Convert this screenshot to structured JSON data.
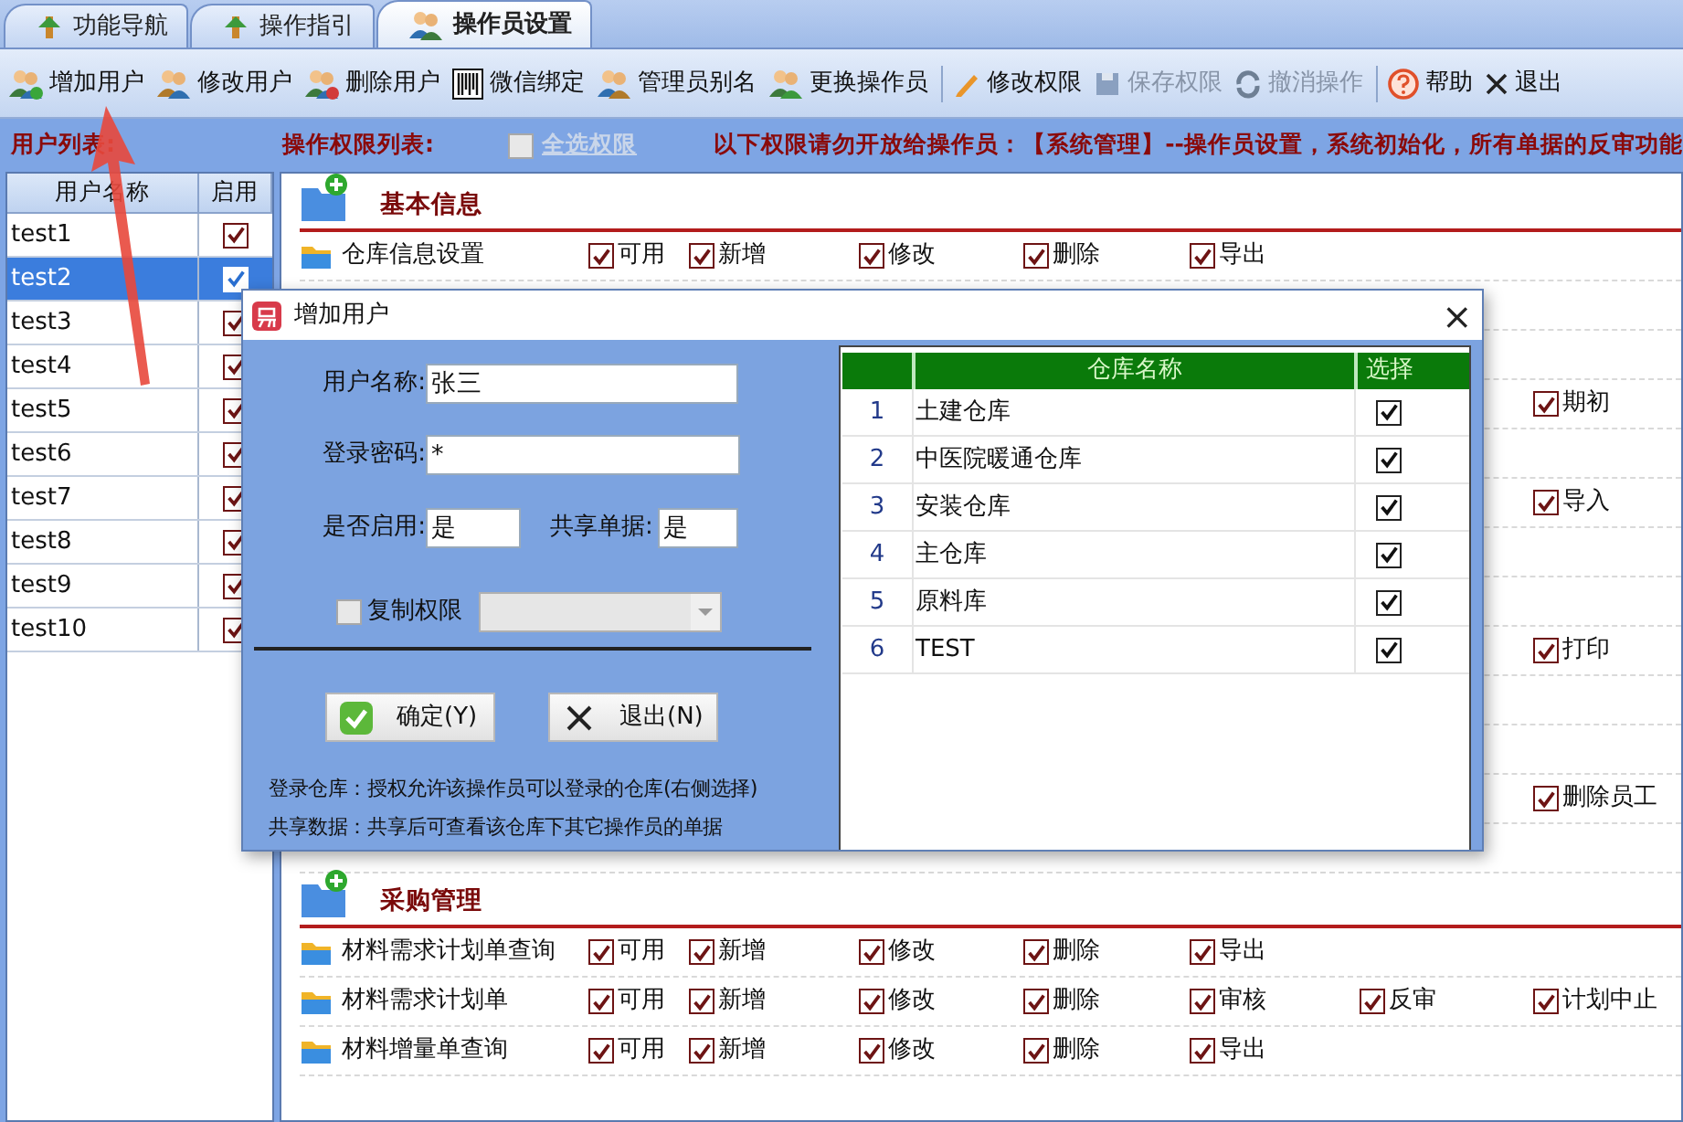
{
  "tabs": [
    {
      "label": "功能导航",
      "selected": false
    },
    {
      "label": "操作指引",
      "selected": false
    },
    {
      "label": "操作员设置",
      "selected": true
    }
  ],
  "toolbar": [
    {
      "kind": "button",
      "label": "增加用户",
      "disabled": false
    },
    {
      "kind": "button",
      "label": "修改用户",
      "disabled": false
    },
    {
      "kind": "button",
      "label": "删除用户",
      "disabled": false
    },
    {
      "kind": "button",
      "label": "微信绑定",
      "disabled": false
    },
    {
      "kind": "button",
      "label": "管理员别名",
      "disabled": false
    },
    {
      "kind": "button",
      "label": "更换操作员",
      "disabled": false
    },
    {
      "kind": "separator"
    },
    {
      "kind": "button",
      "label": "修改权限",
      "disabled": false
    },
    {
      "kind": "button",
      "label": "保存权限",
      "disabled": true
    },
    {
      "kind": "button",
      "label": "撤消操作",
      "disabled": true
    },
    {
      "kind": "separator"
    },
    {
      "kind": "button",
      "label": "帮助",
      "disabled": false
    },
    {
      "kind": "button",
      "label": "退出",
      "disabled": false
    }
  ],
  "user_list": {
    "label": "用户列表:",
    "columns": [
      "用户名称",
      "启用"
    ],
    "rows": [
      {
        "name": "test1",
        "enabled": true,
        "selected": false
      },
      {
        "name": "test2",
        "enabled": true,
        "selected": true
      },
      {
        "name": "test3",
        "enabled": true,
        "selected": false
      },
      {
        "name": "test4",
        "enabled": true,
        "selected": false
      },
      {
        "name": "test5",
        "enabled": true,
        "selected": false
      },
      {
        "name": "test6",
        "enabled": true,
        "selected": false
      },
      {
        "name": "test7",
        "enabled": true,
        "selected": false
      },
      {
        "name": "test8",
        "enabled": true,
        "selected": false
      },
      {
        "name": "test9",
        "enabled": true,
        "selected": false
      },
      {
        "name": "test10",
        "enabled": true,
        "selected": false
      }
    ]
  },
  "permissions": {
    "label": "操作权限列表:",
    "select_all": {
      "label": "全选权限",
      "checked": false,
      "disabled": true
    },
    "notice": "以下权限请勿开放给操作员：【系统管理】--操作员设置，系统初始化，所有单据的反审功能",
    "groups": [
      {
        "title": "基本信息",
        "rows": [
          {
            "kind": "full",
            "name": "仓库信息设置",
            "permissions": [
              {
                "label": "可用",
                "checked": true
              },
              {
                "label": "新增",
                "checked": true
              },
              {
                "label": "修改",
                "checked": true
              },
              {
                "label": "删除",
                "checked": true
              },
              {
                "label": "导出",
                "checked": true
              }
            ]
          },
          {
            "kind": "covered"
          },
          {
            "kind": "covered"
          },
          {
            "kind": "covered",
            "permissions": [
              {
                "label": "期初",
                "checked": true
              }
            ]
          },
          {
            "kind": "covered"
          },
          {
            "kind": "covered",
            "permissions": [
              {
                "label": "导入",
                "checked": true
              }
            ]
          },
          {
            "kind": "covered"
          },
          {
            "kind": "covered"
          },
          {
            "kind": "covered",
            "permissions": [
              {
                "label": "打印",
                "checked": true
              }
            ]
          },
          {
            "kind": "covered"
          },
          {
            "kind": "covered"
          },
          {
            "kind": "covered",
            "permissions": [
              {
                "label": "删除员工",
                "checked": true
              }
            ]
          },
          {
            "kind": "covered"
          }
        ]
      },
      {
        "title": "采购管理",
        "rows": [
          {
            "kind": "full",
            "name": "材料需求计划单查询",
            "permissions": [
              {
                "label": "可用",
                "checked": true
              },
              {
                "label": "新增",
                "checked": true
              },
              {
                "label": "修改",
                "checked": true
              },
              {
                "label": "删除",
                "checked": true
              },
              {
                "label": "导出",
                "checked": true
              }
            ]
          },
          {
            "kind": "full",
            "name": "材料需求计划单",
            "permissions": [
              {
                "label": "可用",
                "checked": true
              },
              {
                "label": "新增",
                "checked": true
              },
              {
                "label": "修改",
                "checked": true
              },
              {
                "label": "删除",
                "checked": true
              },
              {
                "label": "审核",
                "checked": true
              },
              {
                "label": "反审",
                "checked": true
              },
              {
                "label": "计划中止",
                "checked": true
              }
            ]
          },
          {
            "kind": "full",
            "name": "材料增量单查询",
            "permissions": [
              {
                "label": "可用",
                "checked": true
              },
              {
                "label": "新增",
                "checked": true
              },
              {
                "label": "修改",
                "checked": true
              },
              {
                "label": "删除",
                "checked": true
              },
              {
                "label": "导出",
                "checked": true
              }
            ]
          }
        ]
      }
    ]
  },
  "dialog": {
    "title": "增加用户",
    "close": "×",
    "fields": [
      {
        "label": "用户名称:",
        "value": "张三"
      },
      {
        "label": "登录密码:",
        "value": "*"
      },
      {
        "label": "是否启用:",
        "value": "是"
      },
      {
        "label": "共享单据:",
        "value": "是"
      }
    ],
    "copy_permissions": {
      "label": "复制权限",
      "checked": false
    },
    "buttons": [
      {
        "kind": "ok",
        "label": "确定(Y)"
      },
      {
        "kind": "cancel",
        "label": "退出(N)"
      }
    ],
    "notes": [
      "登录仓库：授权允许该操作员可以登录的仓库(右侧选择)",
      "共享数据：共享后可查看该仓库下其它操作员的单据"
    ],
    "warehouses": {
      "columns": [
        "仓库名称",
        "选择"
      ],
      "rows": [
        {
          "number": "1",
          "name": "土建仓库",
          "checked": true
        },
        {
          "number": "2",
          "name": "中医院暖通仓库",
          "checked": true
        },
        {
          "number": "3",
          "name": "安装仓库",
          "checked": true
        },
        {
          "number": "4",
          "name": "主仓库",
          "checked": true
        },
        {
          "number": "5",
          "name": "原料库",
          "checked": true
        },
        {
          "number": "6",
          "name": "TEST",
          "checked": true
        }
      ]
    }
  }
}
